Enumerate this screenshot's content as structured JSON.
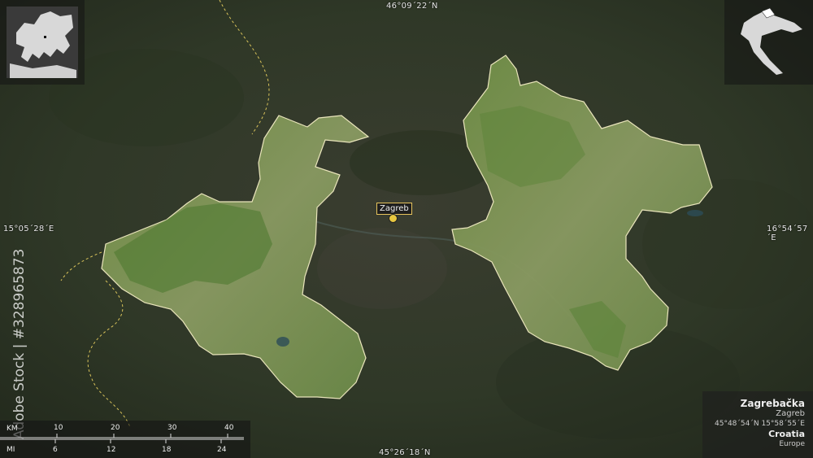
{
  "coordinates": {
    "top": "46°09´22´N",
    "bottom": "45°26´18´N",
    "left": "15°05´28´E",
    "right": "16°54´57´E"
  },
  "city": {
    "label": "Zagreb"
  },
  "info": {
    "region_name": "Zagrebačka",
    "admin_center": "Zagreb",
    "center_coords": "45°48´54´N 15°58´55´E",
    "country": "Croatia",
    "continent": "Europe"
  },
  "scale": {
    "km_label": "KM",
    "mi_label": "MI",
    "km_ticks": [
      "10",
      "20",
      "30",
      "40"
    ],
    "mi_ticks": [
      "6",
      "12",
      "18",
      "24"
    ]
  },
  "watermark": {
    "text": "Adobe Stock | #328965873"
  },
  "colors": {
    "region_fill": "#7a9450",
    "region_border": "#f4efc4",
    "city_marker": "#e8c840",
    "background": "#2c3324"
  },
  "icons": {
    "city_marker": "circle-marker-icon",
    "europe_inset": "europe-locator-map",
    "country_inset": "croatia-locator-map"
  }
}
